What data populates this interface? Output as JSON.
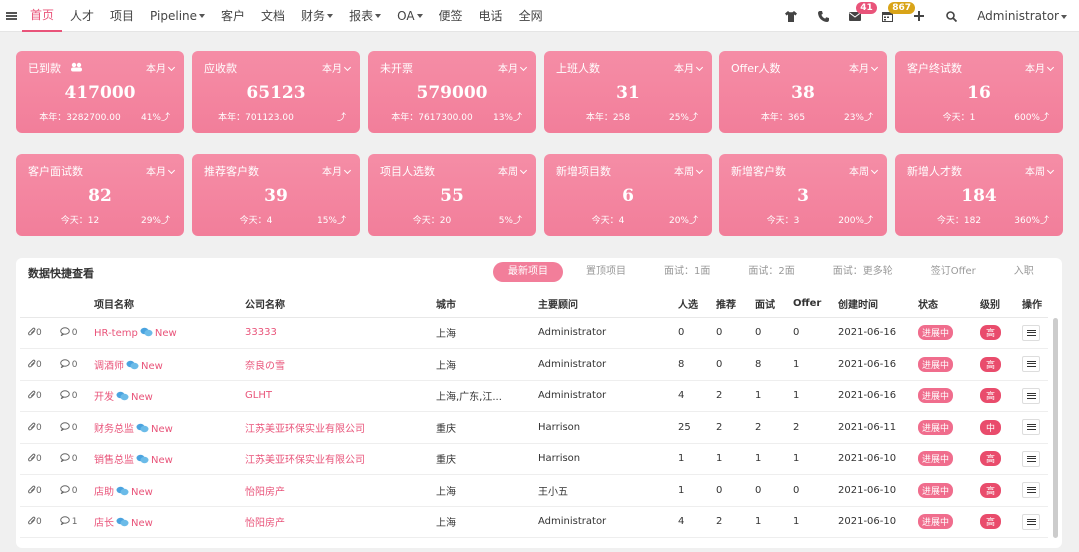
{
  "nav": {
    "items": [
      {
        "label": "首页",
        "dropdown": false
      },
      {
        "label": "人才",
        "dropdown": false
      },
      {
        "label": "项目",
        "dropdown": false
      },
      {
        "label": "Pipeline",
        "dropdown": true
      },
      {
        "label": "客户",
        "dropdown": false
      },
      {
        "label": "文档",
        "dropdown": false
      },
      {
        "label": "财务",
        "dropdown": true
      },
      {
        "label": "报表",
        "dropdown": true
      },
      {
        "label": "OA",
        "dropdown": true
      },
      {
        "label": "便签",
        "dropdown": false
      },
      {
        "label": "电话",
        "dropdown": false
      },
      {
        "label": "全网",
        "dropdown": false
      }
    ],
    "active_index": 0,
    "mail_count": "41",
    "calendar_count": "867",
    "user": "Administrator"
  },
  "cards": [
    {
      "title": "已到款",
      "period": "本月",
      "value": "417000",
      "sub": "本年：3282700.00",
      "rate": "41%"
    },
    {
      "title": "应收款",
      "period": "本月",
      "value": "65123",
      "sub": "本年：701123.00",
      "rate": ""
    },
    {
      "title": "未开票",
      "period": "本月",
      "value": "579000",
      "sub": "本年：7617300.00",
      "rate": "13%"
    },
    {
      "title": "上班人数",
      "period": "本月",
      "value": "31",
      "sub": "本年：258",
      "rate": "25%"
    },
    {
      "title": "Offer人数",
      "period": "本月",
      "value": "38",
      "sub": "本年：365",
      "rate": "23%"
    },
    {
      "title": "客户终试数",
      "period": "本月",
      "value": "16",
      "sub": "今天：1",
      "rate": "600%"
    },
    {
      "title": "客户面试数",
      "period": "本月",
      "value": "82",
      "sub": "今天：12",
      "rate": "29%"
    },
    {
      "title": "推荐客户数",
      "period": "本月",
      "value": "39",
      "sub": "今天：4",
      "rate": "15%"
    },
    {
      "title": "项目人选数",
      "period": "本周",
      "value": "55",
      "sub": "今天：20",
      "rate": "5%"
    },
    {
      "title": "新增项目数",
      "period": "本周",
      "value": "6",
      "sub": "今天：4",
      "rate": "20%"
    },
    {
      "title": "新增客户数",
      "period": "本周",
      "value": "3",
      "sub": "今天：3",
      "rate": "200%"
    },
    {
      "title": "新增人才数",
      "period": "本周",
      "value": "184",
      "sub": "今天：182",
      "rate": "360%"
    }
  ],
  "panel": {
    "title": "数据快捷查看",
    "tabs": [
      "最新项目",
      "置顶项目",
      "面试：1面",
      "面试：2面",
      "面试：更多轮",
      "签订Offer",
      "入职"
    ],
    "active_tab": 0,
    "columns": [
      "",
      "项目名称",
      "公司名称",
      "城市",
      "主要顾问",
      "人选",
      "推荐",
      "面试",
      "Offer",
      "创建时间",
      "状态",
      "级别",
      "操作"
    ],
    "new_label": "New",
    "rows": [
      {
        "attach": "0",
        "comment": "0",
        "project": "HR-temp",
        "company": "33333",
        "city": "上海",
        "consultant": "Administrator",
        "candidates": "0",
        "recommend": "0",
        "interview": "0",
        "offer": "0",
        "created": "2021-06-16",
        "status": "进展中",
        "level": "高"
      },
      {
        "attach": "0",
        "comment": "0",
        "project": "调酒师",
        "company": "奈良の雪",
        "city": "上海",
        "consultant": "Administrator",
        "candidates": "8",
        "recommend": "0",
        "interview": "8",
        "offer": "1",
        "created": "2021-06-16",
        "status": "进展中",
        "level": "高"
      },
      {
        "attach": "0",
        "comment": "0",
        "project": "开发",
        "company": "GLHT",
        "city": "上海,广东,江...",
        "consultant": "Administrator",
        "candidates": "4",
        "recommend": "2",
        "interview": "1",
        "offer": "1",
        "created": "2021-06-16",
        "status": "进展中",
        "level": "高"
      },
      {
        "attach": "0",
        "comment": "0",
        "project": "财务总监",
        "company": "江苏美亚环保实业有限公司",
        "city": "重庆",
        "consultant": "Harrison",
        "candidates": "25",
        "recommend": "2",
        "interview": "2",
        "offer": "2",
        "created": "2021-06-11",
        "status": "进展中",
        "level": "中"
      },
      {
        "attach": "0",
        "comment": "0",
        "project": "销售总监",
        "company": "江苏美亚环保实业有限公司",
        "city": "重庆",
        "consultant": "Harrison",
        "candidates": "1",
        "recommend": "1",
        "interview": "1",
        "offer": "1",
        "created": "2021-06-10",
        "status": "进展中",
        "level": "高"
      },
      {
        "attach": "0",
        "comment": "0",
        "project": "店助",
        "company": "怡阳房产",
        "city": "上海",
        "consultant": "王小五",
        "candidates": "1",
        "recommend": "0",
        "interview": "0",
        "offer": "0",
        "created": "2021-06-10",
        "status": "进展中",
        "level": "高"
      },
      {
        "attach": "0",
        "comment": "1",
        "project": "店长",
        "company": "怡阳房产",
        "city": "上海",
        "consultant": "Administrator",
        "candidates": "4",
        "recommend": "2",
        "interview": "1",
        "offer": "1",
        "created": "2021-06-10",
        "status": "进展中",
        "level": "高"
      }
    ]
  }
}
